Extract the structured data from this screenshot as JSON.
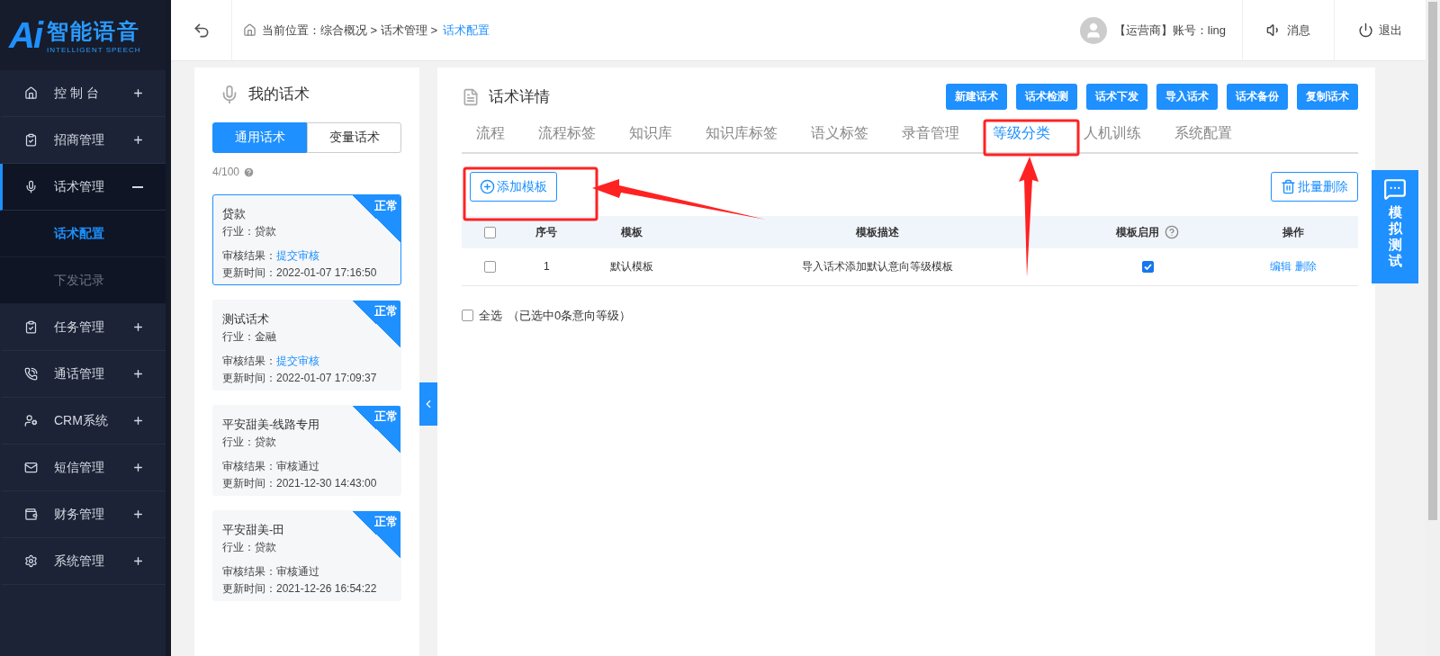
{
  "logo": {
    "mark": "Ai",
    "title": "智能语音",
    "subtitle": "INTELLIGENT SPEECH"
  },
  "sidebar": {
    "items": [
      {
        "label": "控 制 台",
        "expanded": false
      },
      {
        "label": "招商管理",
        "expanded": false
      },
      {
        "label": "话术管理",
        "expanded": true,
        "children": [
          {
            "label": "话术配置",
            "selected": true
          },
          {
            "label": "下发记录",
            "selected": false
          }
        ]
      },
      {
        "label": "任务管理",
        "expanded": false
      },
      {
        "label": "通话管理",
        "expanded": false
      },
      {
        "label": "CRM系统",
        "expanded": false
      },
      {
        "label": "短信管理",
        "expanded": false
      },
      {
        "label": "财务管理",
        "expanded": false
      },
      {
        "label": "系统管理",
        "expanded": false
      }
    ]
  },
  "topbar": {
    "breadcrumb": {
      "path": "当前位置：综合概况 > 话术管理 >",
      "current": "话术配置"
    },
    "account": "【运营商】账号：ling",
    "actions": [
      "消息",
      "退出"
    ]
  },
  "scripts_panel": {
    "title": "我的话术",
    "tabs": [
      {
        "label": "通用话术",
        "selected": true
      },
      {
        "label": "变量话术",
        "selected": false
      }
    ],
    "count": "4/100",
    "cards": [
      {
        "name": "贷款",
        "industry": "行业：贷款",
        "review_label": "审核结果：",
        "review": "提交审核",
        "review_link": true,
        "updated": "更新时间：2022-01-07 17:16:50",
        "status": "正常",
        "selected": true
      },
      {
        "name": "测试话术",
        "industry": "行业：金融",
        "review_label": "审核结果：",
        "review": "提交审核",
        "review_link": true,
        "updated": "更新时间：2022-01-07 17:09:37",
        "status": "正常",
        "selected": false
      },
      {
        "name": "平安甜美-线路专用",
        "industry": "行业：贷款",
        "review_label": "审核结果：",
        "review": "审核通过",
        "review_link": false,
        "updated": "更新时间：2021-12-30 14:43:00",
        "status": "正常",
        "selected": false
      },
      {
        "name": "平安甜美-田",
        "industry": "行业：贷款",
        "review_label": "审核结果：",
        "review": "审核通过",
        "review_link": false,
        "updated": "更新时间：2021-12-26 16:54:22",
        "status": "正常",
        "selected": false
      }
    ]
  },
  "detail": {
    "title": "话术详情",
    "buttons": [
      "新建话术",
      "话术检测",
      "话术下发",
      "导入话术",
      "话术备份",
      "复制话术"
    ],
    "tabs": [
      {
        "label": "流程",
        "selected": false
      },
      {
        "label": "流程标签",
        "selected": false
      },
      {
        "label": "知识库",
        "selected": false
      },
      {
        "label": "知识库标签",
        "selected": false
      },
      {
        "label": "语义标签",
        "selected": false
      },
      {
        "label": "录音管理",
        "selected": false
      },
      {
        "label": "等级分类",
        "selected": true
      },
      {
        "label": "人机训练",
        "selected": false
      },
      {
        "label": "系统配置",
        "selected": false
      }
    ],
    "add_button": "添加模板",
    "batch_delete": "批量删除",
    "table": {
      "header_checked": false,
      "columns": [
        {
          "label": "序号",
          "help": false
        },
        {
          "label": "模板",
          "help": false
        },
        {
          "label": "模板描述",
          "help": false
        },
        {
          "label": "模板启用",
          "help": true
        },
        {
          "label": "操作",
          "help": false
        }
      ],
      "rows": [
        {
          "checked": false,
          "index": "1",
          "template": "默认模板",
          "description": "导入话术添加默认意向等级模板",
          "enabled": true,
          "actions": [
            "编辑",
            "删除"
          ]
        }
      ]
    },
    "select_all": {
      "label": "全选",
      "checked": false,
      "note": "（已选中0条意向等级）"
    }
  },
  "float_button": "模拟测试"
}
